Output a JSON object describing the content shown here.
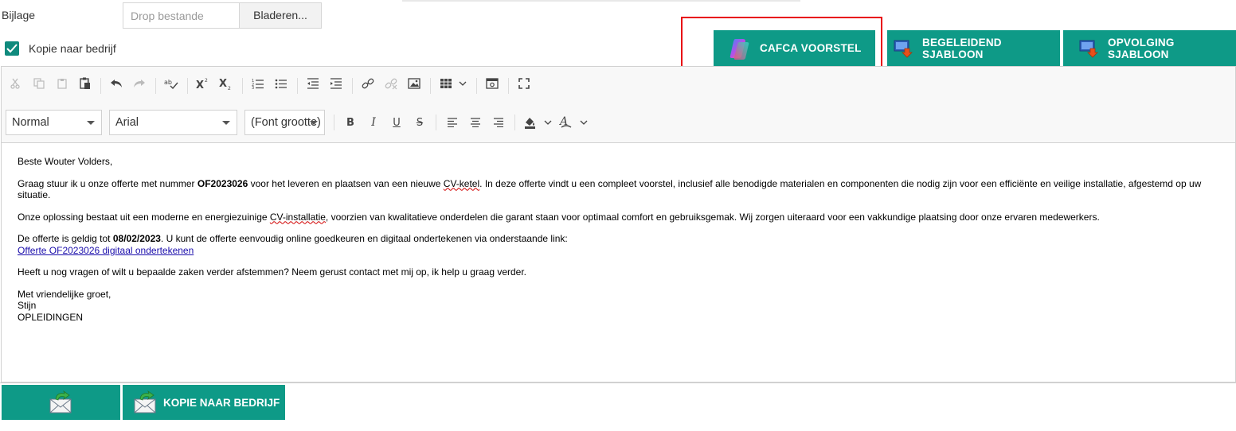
{
  "attachment": {
    "label": "Bijlage",
    "drop_placeholder": "Drop bestande",
    "browse_label": "Bladeren..."
  },
  "copy_company": {
    "label": "Kopie naar bedrijf",
    "checked": true
  },
  "template_buttons": {
    "cafca": "CAFCA VOORSTEL",
    "begeleidend": "BEGELEIDEND SJABLOON",
    "opvolging": "OPVOLGING SJABLOON"
  },
  "editor": {
    "format_select": "Normal",
    "font_select": "Arial",
    "size_select": "(Font grootte)",
    "toolbar_icons": [
      "cut-icon",
      "copy-icon",
      "paste-icon",
      "paste-text-icon",
      "paste-word-icon",
      "undo-icon",
      "redo-icon",
      "spellcheck-icon",
      "superscript-icon",
      "subscript-icon",
      "numbered-list-icon",
      "bulleted-list-icon",
      "outdent-icon",
      "indent-icon",
      "link-icon",
      "unlink-icon",
      "image-icon",
      "table-icon",
      "preview-icon",
      "fullscreen-icon",
      "bold-icon",
      "italic-icon",
      "underline-icon",
      "strikethrough-icon",
      "align-left-icon",
      "align-center-icon",
      "align-right-icon",
      "background-color-icon",
      "text-color-icon"
    ]
  },
  "message": {
    "greeting": "Beste Wouter Volders,",
    "p1_a": "Graag stuur ik u onze offerte met nummer ",
    "p1_number": "OF2023026",
    "p1_b": " voor het leveren en plaatsen van een nieuwe ",
    "p1_word": "CV-ketel",
    "p1_c": ". In deze offerte vindt u een compleet voorstel, inclusief alle benodigde materialen en componenten die nodig zijn voor een efficiënte en veilige installatie, afgestemd op uw situatie.",
    "p2_a": "Onze oplossing bestaat uit een moderne en energiezuinige ",
    "p2_word": "CV-installatie",
    "p2_b": ", voorzien van kwalitatieve onderdelen die garant staan voor optimaal comfort en gebruiksgemak. Wij zorgen uiteraard voor een vakkundige plaatsing door onze ervaren medewerkers.",
    "p3_a": "De offerte is geldig tot ",
    "p3_date": "08/02/2023",
    "p3_b": ". U kunt de offerte eenvoudig online goedkeuren en digitaal ondertekenen via onderstaande link:",
    "link_text": "Offerte OF2023026 digitaal ondertekenen",
    "p4": "Heeft u nog vragen of wilt u bepaalde zaken verder afstemmen? Neem gerust contact met mij op, ik help u graag verder.",
    "closing": "Met vriendelijke groet,",
    "name": "Stijn",
    "company": "OPLEIDINGEN"
  },
  "bottom_buttons": {
    "send_kopie_label": "KOPIE NAAR BEDRIJF"
  },
  "colors": {
    "accent": "#0e9a87",
    "highlight_box": "#e8000b",
    "link": "#1a0dab"
  }
}
